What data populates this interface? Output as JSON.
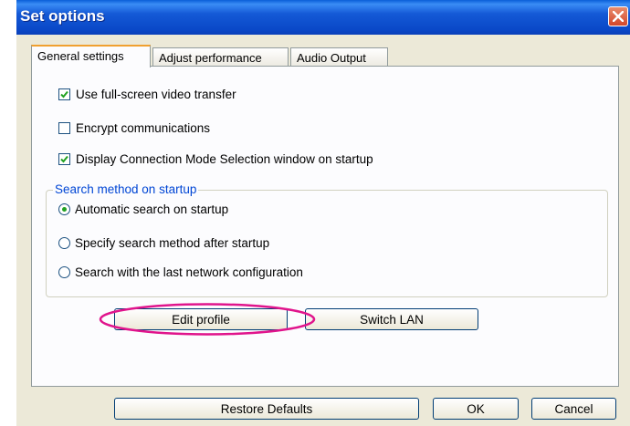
{
  "window": {
    "title": "Set options"
  },
  "tabs": [
    {
      "label": "General settings",
      "active": true
    },
    {
      "label": "Adjust performance",
      "active": false
    },
    {
      "label": "Audio Output",
      "active": false
    }
  ],
  "options": [
    {
      "label": "Use full-screen video transfer",
      "checked": true
    },
    {
      "label": "Encrypt communications",
      "checked": false
    },
    {
      "label": "Display Connection Mode Selection window on startup",
      "checked": true
    }
  ],
  "search_group": {
    "label": "Search method on startup",
    "radios": [
      {
        "label": "Automatic search on startup",
        "selected": true
      },
      {
        "label": "Specify search method after startup",
        "selected": false
      },
      {
        "label": "Search with the last network configuration",
        "selected": false
      }
    ]
  },
  "buttons": {
    "edit_profile": "Edit profile",
    "switch_lan": "Switch LAN",
    "restore_defaults": "Restore Defaults",
    "ok": "OK",
    "cancel": "Cancel"
  },
  "colors": {
    "titlebar": "#0a48c8",
    "highlight_ellipse": "#e0148c",
    "radio_dot": "#21a121",
    "group_label": "#0046d5"
  }
}
